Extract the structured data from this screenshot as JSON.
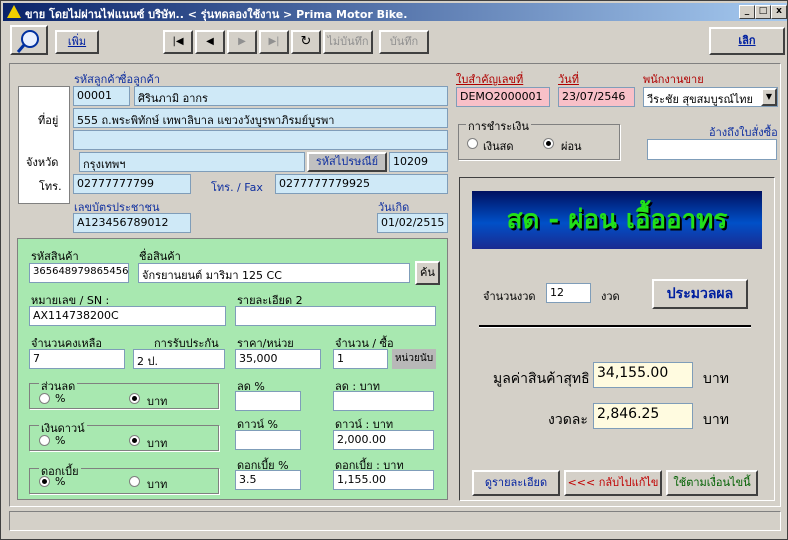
{
  "window": {
    "title": "ขาย โดยไม่ผ่านไฟแนนซ์ บริษัท..  < รุ่นทดลองใช้งาน > Prima Motor Bike.",
    "min": "_",
    "max": "□",
    "close": "x"
  },
  "toolbar": {
    "add": "เพิ่ม",
    "first": "|◀",
    "prev": "◀",
    "next": "▶",
    "last": "▶|",
    "refresh": "↻",
    "nosave": "ไม่บันทึก",
    "save": "บันทึก",
    "exit": "เลิก"
  },
  "customer": {
    "code_label": "รหัสลูกค้า",
    "name_label": "ชื่อลูกค้า",
    "code": "00001",
    "name": "ศิรินภามิ อากร",
    "address_label": "ที่อยู่",
    "address1": "555 ถ.พระพิทักษ์ เทพาลิบาล แขวงวังบูรพาภิรมย์บูรพา",
    "address2": "",
    "province_label": "จังหวัด",
    "province": "กรุงเทพฯ",
    "zip_label": "รหัสไปรษณีย์",
    "zip": "10209",
    "phone_label": "โทร.",
    "phone": "02777777799",
    "fax_label": "โทร. / Fax",
    "fax": "0277777779925",
    "idcard_label": "เลขบัตรประชาชน",
    "idcard": "A123456789012",
    "birth_label": "วันเกิด",
    "birth": "01/02/2515"
  },
  "document": {
    "doc_label": "ใบสำคัญเลขที่",
    "doc_no": "DEMO2000001",
    "date_label": "วันที่",
    "date": "23/07/2546",
    "salesman_label": "พนักงานขาย",
    "salesman": "วีระชัย  สุขสมบูรณ์ไทย",
    "payment_label": "การชำระเงิน",
    "cash": "เงินสด",
    "installment": "ผ่อน",
    "ref_label": "อ้างถึงใบสั่งซื้อ",
    "ref": ""
  },
  "product": {
    "code_label": "รหัสสินค้า",
    "code": "365648979865456",
    "name_label": "ชื่อสินค้า",
    "name": "จักรยานยนต์ มาริมา 125 CC",
    "search": "ค้น",
    "sn_label": "หมายเลข / SN :",
    "sn": "AX114738200C",
    "detail_label": "รายละเอียด 2",
    "detail": "",
    "stock_label": "จำนวนคงเหลือ",
    "stock": "7",
    "warranty_label": "การรับประกัน",
    "warranty": "2 ป.",
    "price_label": "ราคา/หน่วย",
    "price": "35,000",
    "qty_label": "จำนวน / ซื้อ",
    "qty": "1",
    "unit": "หน่วยนับ",
    "discount_group": "ส่วนลด",
    "discount_pct_label": "ลด %",
    "discount_pct": "",
    "discount_amt_label": "ลด : บาท",
    "discount_amt": "",
    "down_group": "เงินดาวน์",
    "down_pct_label": "ดาวน์ %",
    "down_pct": "",
    "down_amt_label": "ดาวน์ : บาท",
    "down_amt": "2,000.00",
    "interest_group": "ดอกเบี้ย",
    "interest_pct_label": "ดอกเบี้ย %",
    "interest_pct": "3.5",
    "interest_amt_label": "ดอกเบี้ย : บาท",
    "interest_amt": "1,155.00",
    "pct": "%",
    "baht": "บาท"
  },
  "summary": {
    "banner": "สด - ผ่อน เอื้ออาทร",
    "periods_label": "จำนวนงวด",
    "periods": "12",
    "periods_unit": "งวด",
    "process": "ประมวลผล",
    "net_label": "มูลค่าสินค้าสุทธิ",
    "net": "34,155.00",
    "per_label": "งวดละ",
    "per": "2,846.25",
    "baht": "บาท",
    "view_detail": "ดูรายละเอียด",
    "back": "<<< กลับไปแก้ไข",
    "use": "ใช้ตามเงื่อนไขนี้"
  },
  "colors": {
    "accent": "#0a246a",
    "form_green": "#a8e8b0",
    "field_blue": "#cfe9f7",
    "field_pink": "#f8c0c8",
    "field_cream": "#fffbe0",
    "banner_text": "#22e01a"
  }
}
